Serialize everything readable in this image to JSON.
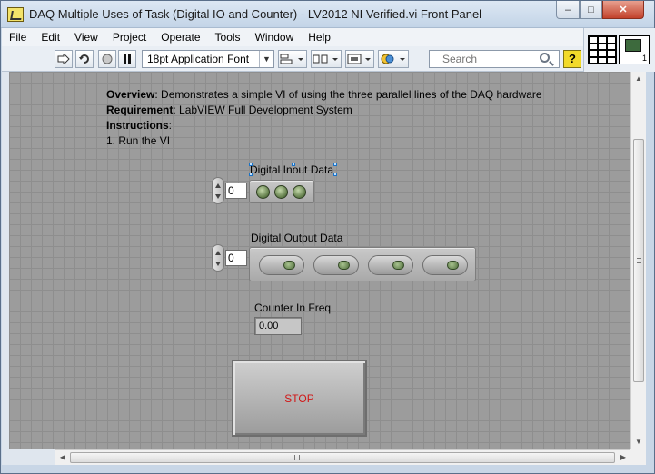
{
  "window": {
    "title": "DAQ Multiple Uses of Task (Digital IO and Counter) - LV2012 NI Verified.vi Front Panel",
    "minimize": "–",
    "maximize": "□",
    "close": "✕"
  },
  "menu": [
    "File",
    "Edit",
    "View",
    "Project",
    "Operate",
    "Tools",
    "Window",
    "Help"
  ],
  "toolbar": {
    "font": "18pt Application Font",
    "search_placeholder": "Search",
    "help": "?"
  },
  "connector": {
    "icon_number": "1"
  },
  "description": {
    "overview_label": "Overview",
    "overview_text": ": Demonstrates a simple VI of using the three parallel lines of the DAQ hardware",
    "requirement_label": "Requirement",
    "requirement_text": ": LabVIEW Full Development System",
    "instructions_label": "Instructions",
    "instructions_suffix": ":",
    "step1": "1. Run the VI"
  },
  "controls": {
    "digital_input": {
      "label": "Digital Inout Data",
      "index": "0",
      "led_count": 3
    },
    "digital_output": {
      "label": "Digital Output Data",
      "index": "0",
      "switch_count": 4
    },
    "counter": {
      "label": "Counter In Freq",
      "value": "0.00"
    },
    "stop": {
      "label": "STOP"
    }
  },
  "colors": {
    "panel_bg": "#9c9c9c",
    "stop_text": "#d01818",
    "led_off": "#5e7a47"
  }
}
